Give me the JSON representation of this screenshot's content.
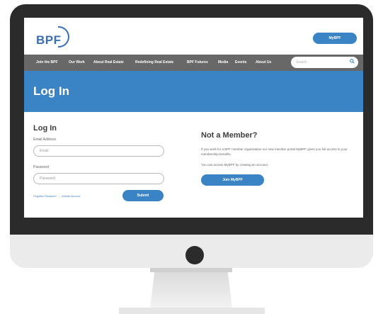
{
  "header": {
    "logo_text": "BPF",
    "mybpf_label": "MyBPF"
  },
  "nav": {
    "items": [
      "Join the BPF",
      "Our Work",
      "About Real Estate",
      "Redefining Real Estate",
      "BPF Futures",
      "Media",
      "Events",
      "About Us"
    ],
    "search_placeholder": "Search"
  },
  "banner": {
    "title": "Log In"
  },
  "login": {
    "title": "Log In",
    "email_label": "Email Address",
    "email_placeholder": "Email",
    "password_label": "Password",
    "password_placeholder": "Password",
    "forgotten_link": "Forgotten Password?",
    "separator": "|",
    "activate_link": "Activate Account",
    "submit_label": "Submit"
  },
  "not_member": {
    "title": "Not a Member?",
    "text1": "If you work for a BPF member organisation our new member portal MyBPF gives you full access to your membership benefits.",
    "text2": "You can access MyBPF by creating an account.",
    "button_label": "Join MyBPF"
  },
  "colors": {
    "brand_blue": "#3a83c4",
    "nav_gray": "#686868",
    "monitor_dark": "#2b2b2b"
  }
}
